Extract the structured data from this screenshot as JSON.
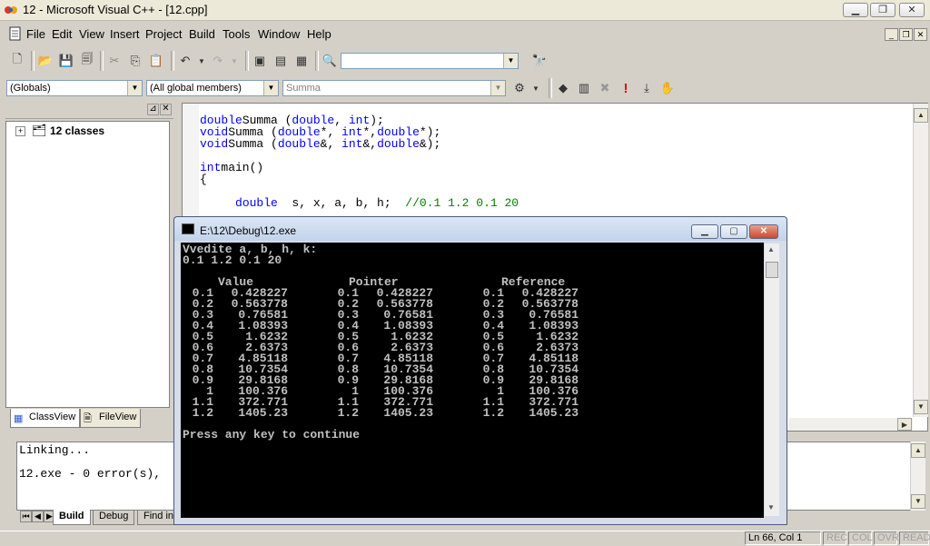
{
  "window": {
    "title": "12 - Microsoft Visual C++ - [12.cpp]",
    "controls": [
      "minimize",
      "maximize",
      "close"
    ]
  },
  "menu": [
    "File",
    "Edit",
    "View",
    "Insert",
    "Project",
    "Build",
    "Tools",
    "Window",
    "Help"
  ],
  "toolbar": {
    "find_combo_value": "",
    "wizard": {
      "scope": "(Globals)",
      "members": "(All global members)",
      "function": "Summa"
    }
  },
  "workspace": {
    "tree_root": "12 classes",
    "tabs": [
      "ClassView",
      "FileView"
    ],
    "active_tab": "ClassView"
  },
  "editor": {
    "lines": [
      {
        "t": [
          [
            "kw",
            "double"
          ],
          [
            "",
            "Summa ("
          ],
          [
            "kw",
            "double"
          ],
          [
            "",
            ", "
          ],
          [
            "kw",
            "int"
          ],
          [
            "",
            ");"
          ]
        ]
      },
      {
        "t": [
          [
            "kw",
            "void"
          ],
          [
            "",
            "Summa ("
          ],
          [
            "kw",
            "double"
          ],
          [
            "",
            "*, "
          ],
          [
            "kw",
            "int"
          ],
          [
            "",
            "*,"
          ],
          [
            "kw",
            "double"
          ],
          [
            "",
            "*);"
          ]
        ]
      },
      {
        "t": [
          [
            "kw",
            "void"
          ],
          [
            "",
            "Summa ("
          ],
          [
            "kw",
            "double"
          ],
          [
            "",
            "&, "
          ],
          [
            "kw",
            "int"
          ],
          [
            "",
            "&,"
          ],
          [
            "kw",
            "double"
          ],
          [
            "",
            "&);"
          ]
        ]
      },
      {
        "t": []
      },
      {
        "t": [
          [
            "kw",
            "int"
          ],
          [
            "",
            "main()"
          ]
        ]
      },
      {
        "t": [
          [
            "",
            "{"
          ]
        ]
      },
      {
        "t": []
      },
      {
        "t": [
          [
            "",
            "     "
          ],
          [
            "kw",
            "double"
          ],
          [
            "",
            "  s, x, a, b, h;  "
          ],
          [
            "cm",
            "//0.1 1.2 0.1 20"
          ]
        ]
      }
    ]
  },
  "output": {
    "lines": [
      "Linking...",
      "",
      "12.exe - 0 error(s),"
    ],
    "tabs": [
      "Build",
      "Debug",
      "Find in"
    ],
    "active_tab": "Build"
  },
  "statusbar": {
    "position": "Ln 66, Col 1",
    "indicators": [
      "REC",
      "COL",
      "OVR",
      "READ"
    ]
  },
  "console": {
    "title": "E:\\12\\Debug\\12.exe",
    "prompt": "Vvedite a, b, h, k:",
    "input": "0.1 1.2 0.1 20",
    "headers": [
      "Value",
      "Pointer",
      "Reference"
    ],
    "rows": [
      [
        "0.1",
        "0.428227"
      ],
      [
        "0.2",
        "0.563778"
      ],
      [
        "0.3",
        "0.76581"
      ],
      [
        "0.4",
        "1.08393"
      ],
      [
        "0.5",
        "1.6232"
      ],
      [
        "0.6",
        "2.6373"
      ],
      [
        "0.7",
        "4.85118"
      ],
      [
        "0.8",
        "10.7354"
      ],
      [
        "0.9",
        "29.8168"
      ],
      [
        "1",
        "100.376"
      ],
      [
        "1.1",
        "372.771"
      ],
      [
        "1.2",
        "1405.23"
      ]
    ],
    "footer": "Press any key to continue"
  }
}
